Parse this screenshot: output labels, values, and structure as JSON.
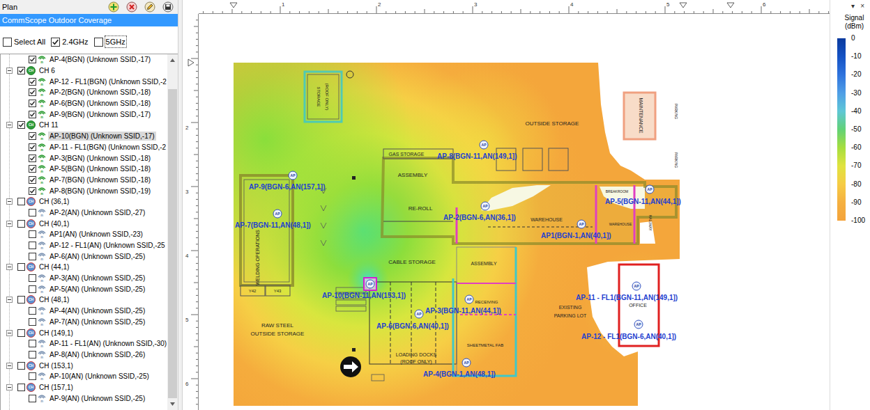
{
  "panel": {
    "title": "Plan",
    "plan": {
      "label": "CommScope Outdoor Coverage",
      "selected": true
    }
  },
  "filters": [
    {
      "label": "Select All",
      "checked": false,
      "focused": false
    },
    {
      "label": "2.4GHz",
      "checked": true,
      "focused": false
    },
    {
      "label": "5GHz",
      "checked": false,
      "focused": true
    }
  ],
  "tree": {
    "group_icon_text": "CH",
    "ap_icon_text": "n",
    "scroll_level": 0.93,
    "rows": [
      {
        "kind": "ap",
        "label": "AP-4(BGN) (Unknown SSID,-17)",
        "checked": true,
        "selected": false
      },
      {
        "kind": "group",
        "label": "CH 6",
        "checked": true,
        "expanded": true,
        "selected": false
      },
      {
        "kind": "ap",
        "label": "AP-12 - FL1(BGN) (Unknown SSID,-2",
        "checked": true,
        "selected": false
      },
      {
        "kind": "ap",
        "label": "AP-2(BGN) (Unknown SSID,-18)",
        "checked": true,
        "selected": false
      },
      {
        "kind": "ap",
        "label": "AP-6(BGN) (Unknown SSID,-18)",
        "checked": true,
        "selected": false
      },
      {
        "kind": "ap",
        "label": "AP-9(BGN) (Unknown SSID,-17)",
        "checked": true,
        "selected": false
      },
      {
        "kind": "group",
        "label": "CH 11",
        "checked": true,
        "expanded": true,
        "selected": false
      },
      {
        "kind": "ap",
        "label": "AP-10(BGN) (Unknown SSID,-17)",
        "checked": true,
        "selected": true
      },
      {
        "kind": "ap",
        "label": "AP-11 - FL1(BGN) (Unknown SSID,-2",
        "checked": true,
        "selected": false
      },
      {
        "kind": "ap",
        "label": "AP-3(BGN) (Unknown SSID,-18)",
        "checked": true,
        "selected": false
      },
      {
        "kind": "ap",
        "label": "AP-5(BGN) (Unknown SSID,-18)",
        "checked": true,
        "selected": false
      },
      {
        "kind": "ap",
        "label": "AP-7(BGN) (Unknown SSID,-18)",
        "checked": true,
        "selected": false
      },
      {
        "kind": "ap",
        "label": "AP-8(BGN) (Unknown SSID,-19)",
        "checked": true,
        "selected": false
      },
      {
        "kind": "group",
        "label": "CH (36,1)",
        "checked": false,
        "expanded": true,
        "selected": false
      },
      {
        "kind": "ap",
        "label": "AP-2(AN) (Unknown SSID,-27)",
        "checked": false,
        "selected": false
      },
      {
        "kind": "group",
        "label": "CH (40,1)",
        "checked": false,
        "expanded": true,
        "selected": false
      },
      {
        "kind": "ap",
        "label": "AP1(AN) (Unknown SSID,-23)",
        "checked": false,
        "selected": false
      },
      {
        "kind": "ap",
        "label": "AP-12 - FL1(AN) (Unknown SSID,-25",
        "checked": false,
        "selected": false
      },
      {
        "kind": "ap",
        "label": "AP-6(AN) (Unknown SSID,-25)",
        "checked": false,
        "selected": false
      },
      {
        "kind": "group",
        "label": "CH (44,1)",
        "checked": false,
        "expanded": true,
        "selected": false
      },
      {
        "kind": "ap",
        "label": "AP-3(AN) (Unknown SSID,-25)",
        "checked": false,
        "selected": false
      },
      {
        "kind": "ap",
        "label": "AP-5(AN) (Unknown SSID,-25)",
        "checked": false,
        "selected": false
      },
      {
        "kind": "group",
        "label": "CH (48,1)",
        "checked": false,
        "expanded": true,
        "selected": false
      },
      {
        "kind": "ap",
        "label": "AP-4(AN) (Unknown SSID,-25)",
        "checked": false,
        "selected": false
      },
      {
        "kind": "ap",
        "label": "AP-7(AN) (Unknown SSID,-25)",
        "checked": false,
        "selected": false
      },
      {
        "kind": "group",
        "label": "CH (149,1)",
        "checked": false,
        "expanded": true,
        "selected": false
      },
      {
        "kind": "ap",
        "label": "AP-11 - FL1(AN) (Unknown SSID,-30)",
        "checked": false,
        "selected": false
      },
      {
        "kind": "ap",
        "label": "AP-8(AN) (Unknown SSID,-26)",
        "checked": false,
        "selected": false
      },
      {
        "kind": "group",
        "label": "CH (153,1)",
        "checked": false,
        "expanded": true,
        "selected": false
      },
      {
        "kind": "ap",
        "label": "AP-10(AN) (Unknown SSID,-25)",
        "checked": false,
        "selected": false
      },
      {
        "kind": "group",
        "label": "CH (157,1)",
        "checked": false,
        "expanded": true,
        "selected": false
      },
      {
        "kind": "ap",
        "label": "AP-9(AN) (Unknown SSID,-25)",
        "checked": false,
        "selected": false
      }
    ]
  },
  "ruler": {
    "top_ticks": [
      "1",
      "2",
      "3",
      "4",
      "5",
      "6"
    ],
    "left_ticks": [
      "2",
      "3",
      "4",
      "5",
      "6"
    ]
  },
  "map": {
    "pin_text": "AP",
    "areas": [
      {
        "label": "STORAGE"
      },
      {
        "label": "(ROOF ONLY)"
      },
      {
        "label": "OUTSIDE STORAGE"
      },
      {
        "label": "MAINTENANCE"
      },
      {
        "label": "PARKING"
      },
      {
        "label": "PARKING"
      },
      {
        "label": "GAS STORAGE"
      },
      {
        "label": "ASSEMBLY"
      },
      {
        "label": "RE-ROLL"
      },
      {
        "label": "WAREHOUSE"
      },
      {
        "label": "BREAKROOM"
      },
      {
        "label": "WAREHOUSE"
      },
      {
        "label": "HALLWAY"
      },
      {
        "label": "WELDING OPERATIONS"
      },
      {
        "label": "CABLE STORAGE"
      },
      {
        "label": "ASSEMBLY"
      },
      {
        "label": "RECEIVING"
      },
      {
        "label": "SHEETMETAL FAB"
      },
      {
        "label": "LOADING DOCKS"
      },
      {
        "label": "(ROOF ONLY)"
      },
      {
        "label": "RAW STEEL"
      },
      {
        "label": "OUTSIDE STORAGE"
      },
      {
        "label": "EXISTING"
      },
      {
        "label": "PARKING LOT"
      },
      {
        "label": "OFFICE"
      },
      {
        "label": "Y42"
      },
      {
        "label": "Y43"
      }
    ],
    "access_points": [
      {
        "label": "AP-9(BGN-6,AN(157,1])",
        "selected": false
      },
      {
        "label": "AP-7(BGN-11,AN(48,1])",
        "selected": false
      },
      {
        "label": "AP-8(BGN-11,AN(149,1])",
        "selected": false
      },
      {
        "label": "AP-2(BGN-6,AN(36,1])",
        "selected": false
      },
      {
        "label": "AP-5(BGN-11,AN(44,1])",
        "selected": false
      },
      {
        "label": "AP1(BGN-1,AN(40,1])",
        "selected": false
      },
      {
        "label": "AP-10(BGN-11,AN(153,1])",
        "selected": true
      },
      {
        "label": "AP-3(BGN-11,AN(44,1])",
        "selected": false
      },
      {
        "label": "AP-6(BGN-6,AN(40,1])",
        "selected": false
      },
      {
        "label": "AP-11 - FL1(BGN-11,AN(149,1])",
        "selected": false
      },
      {
        "label": "AP-12 - FL1(BGN-6,AN(40,1])",
        "selected": false
      },
      {
        "label": "AP-4(BGN-1,AN(48,1])",
        "selected": false
      }
    ]
  },
  "legend": {
    "glyphs": [
      "▾",
      "×"
    ],
    "title": "Signal",
    "unit": "(dBm)",
    "stops": [
      {
        "label": "0",
        "color": "#0a3a9e"
      },
      {
        "label": "-10",
        "color": "#1552c4"
      },
      {
        "label": "-20",
        "color": "#2f73dd"
      },
      {
        "label": "-30",
        "color": "#4f9ee6"
      },
      {
        "label": "-40",
        "color": "#5fc7d6"
      },
      {
        "label": "-50",
        "color": "#62d277"
      },
      {
        "label": "-60",
        "color": "#a6de3f"
      },
      {
        "label": "-70",
        "color": "#e0e33f"
      },
      {
        "label": "-80",
        "color": "#f6cc45"
      },
      {
        "label": "-90",
        "color": "#f5b040"
      },
      {
        "label": "-100",
        "color": "#f4a33b"
      }
    ]
  }
}
